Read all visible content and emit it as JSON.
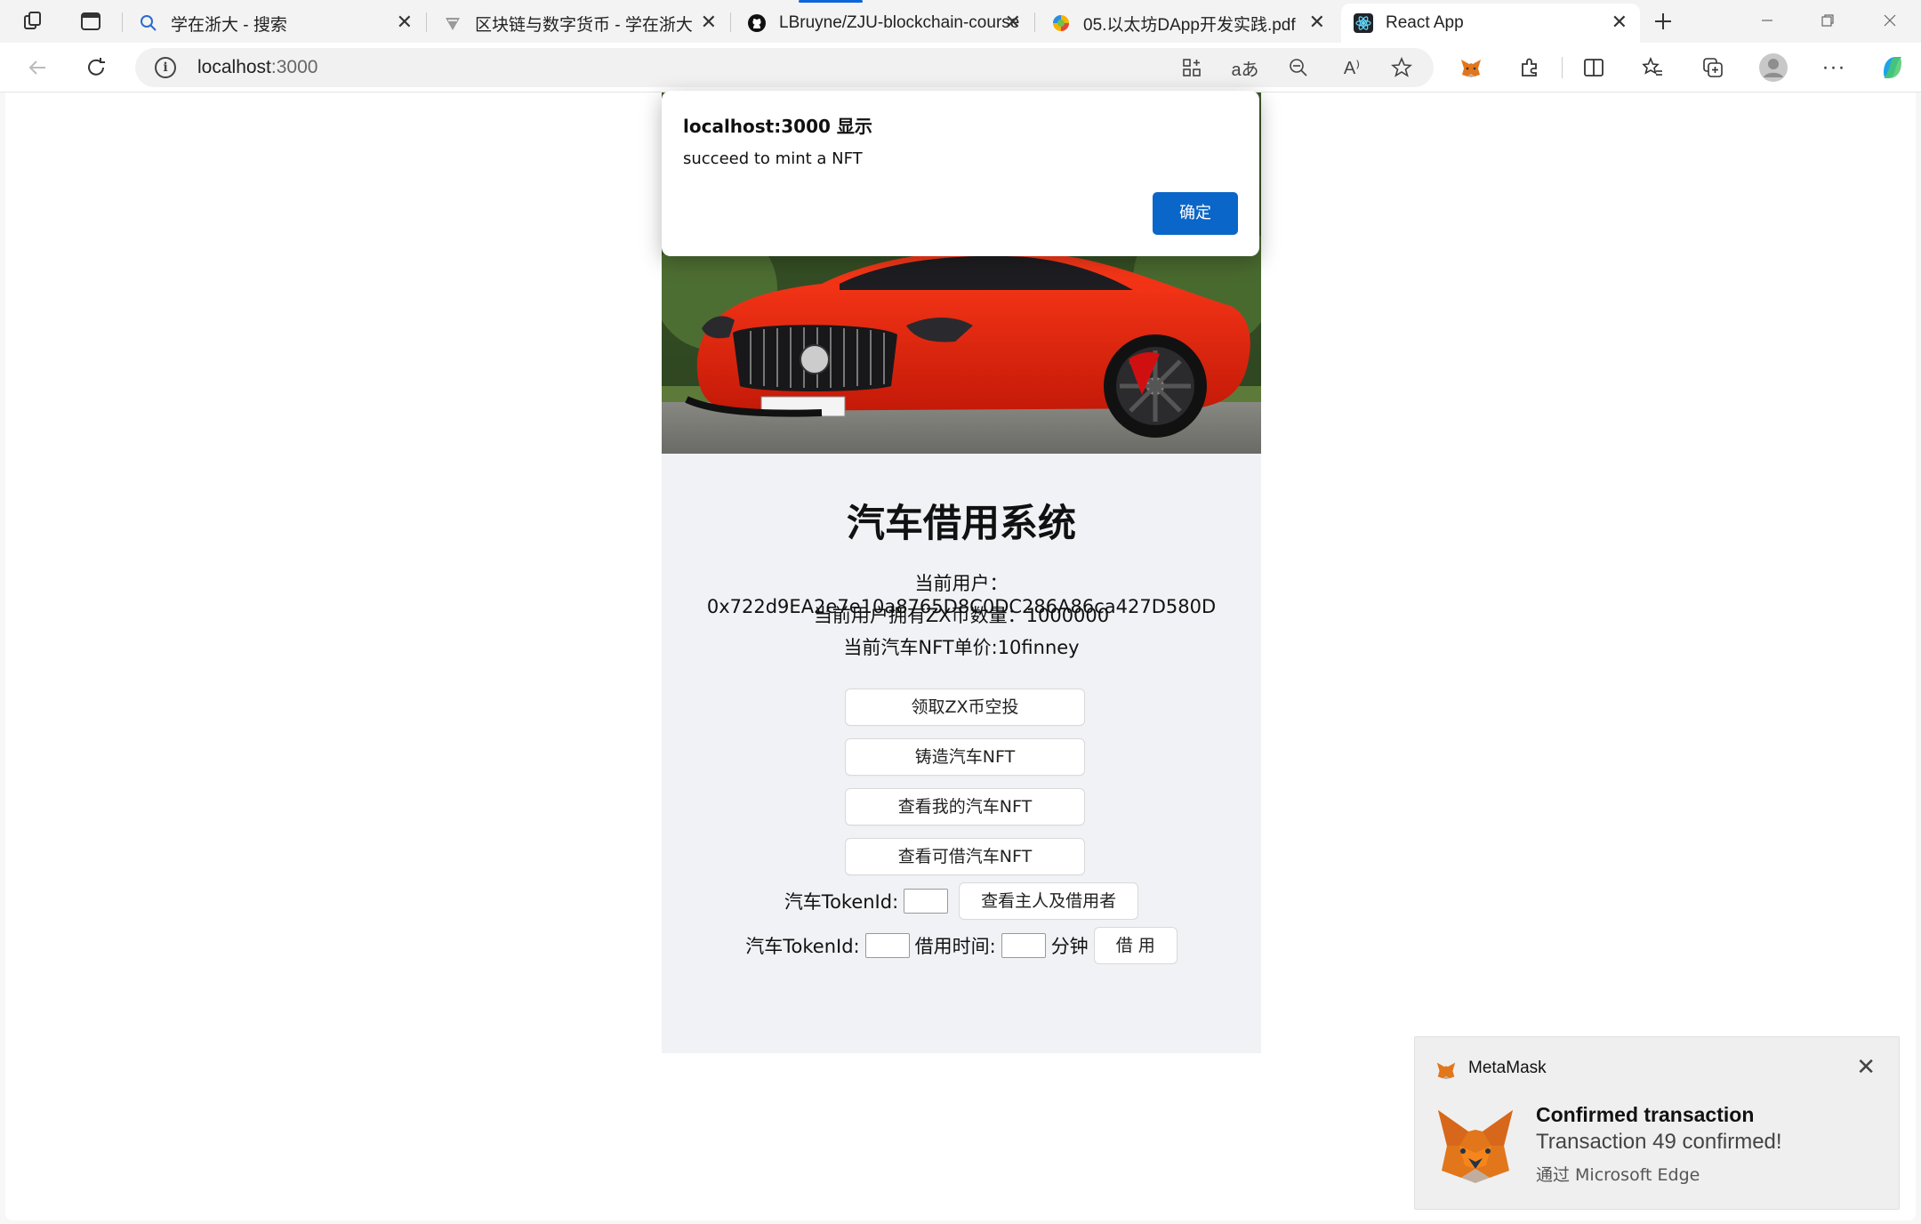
{
  "browser": {
    "tabs": [
      {
        "title": "学在浙大 - 搜索",
        "icon": "search-icon"
      },
      {
        "title": "区块链与数字货币 - 学在浙大",
        "icon": "zju-icon"
      },
      {
        "title": "LBruyne/ZJU-blockchain-course",
        "icon": "github-icon"
      },
      {
        "title": "05.以太坊DApp开发实践.pdf",
        "icon": "pdf-icon"
      },
      {
        "title": "React App",
        "icon": "react-icon"
      }
    ],
    "url_host": "localhost",
    "url_port": ":3000"
  },
  "app": {
    "title": "汽车借用系统",
    "current_user": "当前用户：0x722d9EA2e7e10a8765D8C0DC286A86ca427D580D",
    "zx_balance": "当前用户拥有ZX币数量：1000000",
    "nft_price": "当前汽车NFT单价:10finney",
    "buttons": {
      "airdrop": "领取ZX币空投",
      "mint": "铸造汽车NFT",
      "my_nft": "查看我的汽车NFT",
      "available_nft": "查看可借汽车NFT"
    },
    "query_row": {
      "label": "汽车TokenId:",
      "button": "查看主人及借用者"
    },
    "borrow_row": {
      "token_label": "汽车TokenId:",
      "time_label": "借用时间:",
      "unit": "分钟",
      "button": "借 用"
    }
  },
  "alert": {
    "title": "localhost:3000 显示",
    "message": "succeed to mint a NFT",
    "ok": "确定"
  },
  "toast": {
    "app": "MetaMask",
    "title": "Confirmed transaction",
    "body": "Transaction 49 confirmed!",
    "source": "通过 Microsoft Edge"
  }
}
